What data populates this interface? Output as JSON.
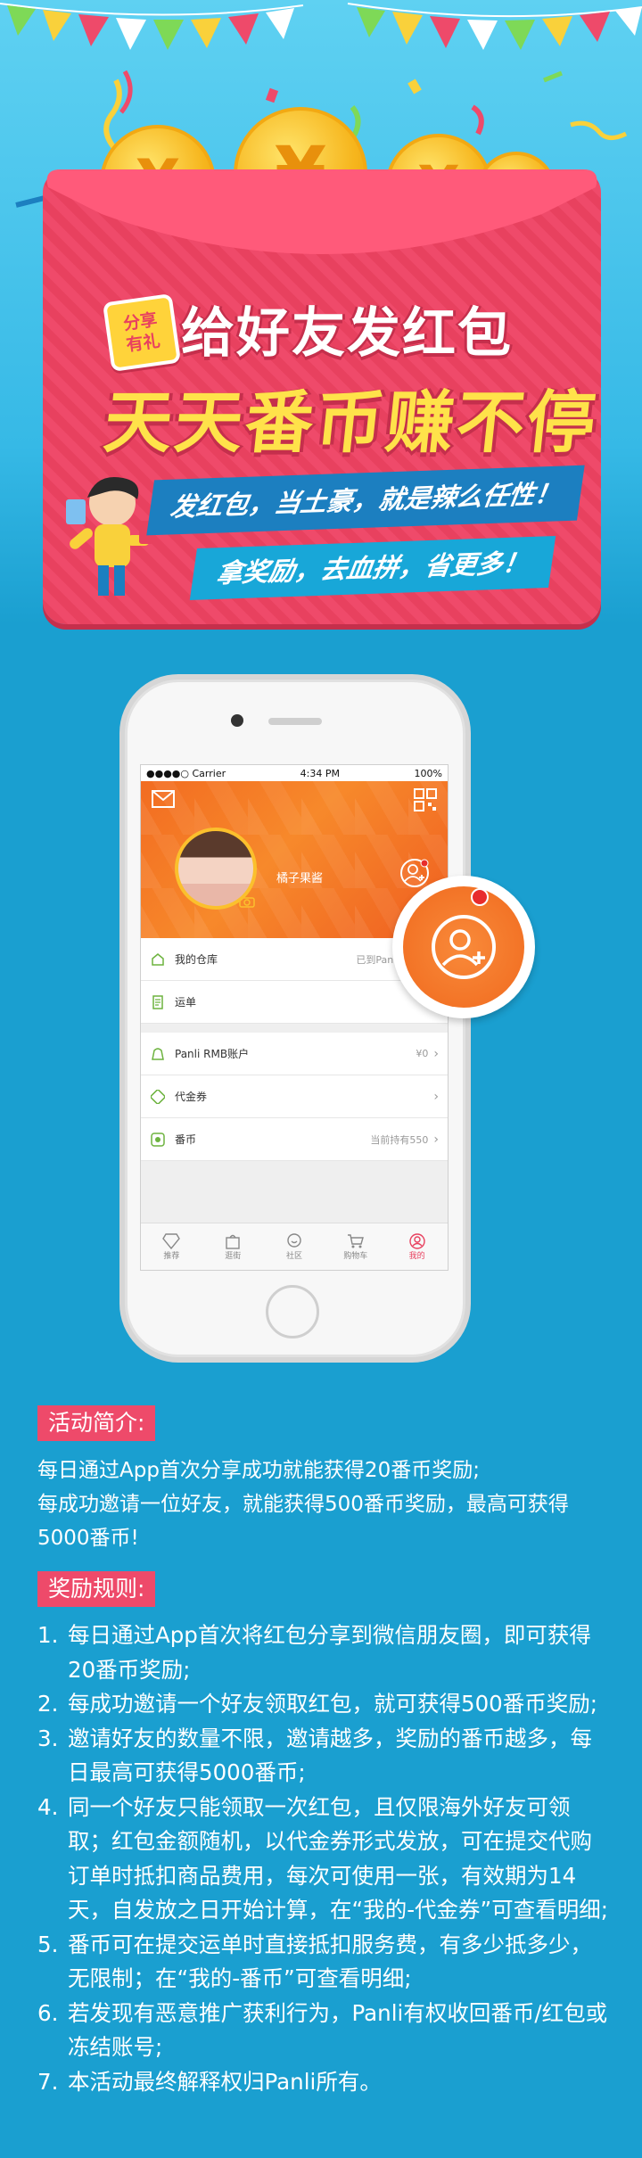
{
  "hero": {
    "badge_line1": "分享",
    "badge_line2": "有礼",
    "title_line1": "给好友发红包",
    "title_line2": "天天番币赚不停",
    "banner_line1": "发红包，当土豪，就是辣么任性！",
    "banner_line2": "拿奖励，去血拼，省更多！",
    "coin_symbol": "¥"
  },
  "phone": {
    "status": {
      "carrier": "●●●●○ Carrier",
      "time": "4:34 PM",
      "battery": "100%"
    },
    "profile": {
      "username": "橘子果酱"
    },
    "rows": [
      {
        "label": "我的仓库",
        "value": "已到Panli可提交",
        "icon": "warehouse-icon"
      },
      {
        "label": "运单",
        "value": "",
        "icon": "waybill-icon"
      },
      {
        "label": "Panli RMB账户",
        "value": "¥0",
        "icon": "wallet-icon"
      },
      {
        "label": "代金券",
        "value": "",
        "icon": "coupon-icon"
      },
      {
        "label": "番币",
        "value": "当前持有550",
        "icon": "coin-icon"
      }
    ],
    "tabs": [
      {
        "label": "推荐",
        "icon": "diamond-icon"
      },
      {
        "label": "逛街",
        "icon": "bag-icon"
      },
      {
        "label": "社区",
        "icon": "chat-icon"
      },
      {
        "label": "购物车",
        "icon": "cart-icon"
      },
      {
        "label": "我的",
        "icon": "user-icon",
        "active": true
      }
    ]
  },
  "intro": {
    "heading": "活动简介:",
    "line1": "每日通过App首次分享成功就能获得20番币奖励;",
    "line2": "每成功邀请一位好友，就能获得500番币奖励，最高可获得5000番币!"
  },
  "rules": {
    "heading": "奖励规则:",
    "items": [
      {
        "num": "1.",
        "text": "每日通过App首次将红包分享到微信朋友圈，即可获得20番币奖励;"
      },
      {
        "num": "2.",
        "text": "每成功邀请一个好友领取红包，就可获得500番币奖励;"
      },
      {
        "num": "3.",
        "text": "邀请好友的数量不限，邀请越多，奖励的番币越多，每日最高可获得5000番币;"
      },
      {
        "num": "4.",
        "text": "同一个好友只能领取一次红包，且仅限海外好友可领取；红包金额随机，以代金券形式发放，可在提交代购订单时抵扣商品费用，每次可使用一张，有效期为14天，自发放之日开始计算，在“我的-代金券”可查看明细;"
      },
      {
        "num": "5.",
        "text": "番币可在提交运单时直接抵扣服务费，有多少抵多少，无限制；在“我的-番币”可查看明细;"
      },
      {
        "num": "6.",
        "text": "若发现有恶意推广获利行为，Panli有权收回番币/红包或冻结账号;"
      },
      {
        "num": "7.",
        "text": "本活动最终解释权归Panli所有。"
      }
    ]
  },
  "colors": {
    "sky": "#5fd1f2",
    "deep_blue": "#1a9fd0",
    "envelope": "#ef4a6a",
    "gold": "#ffe24a",
    "accent_orange": "#f26c21"
  }
}
